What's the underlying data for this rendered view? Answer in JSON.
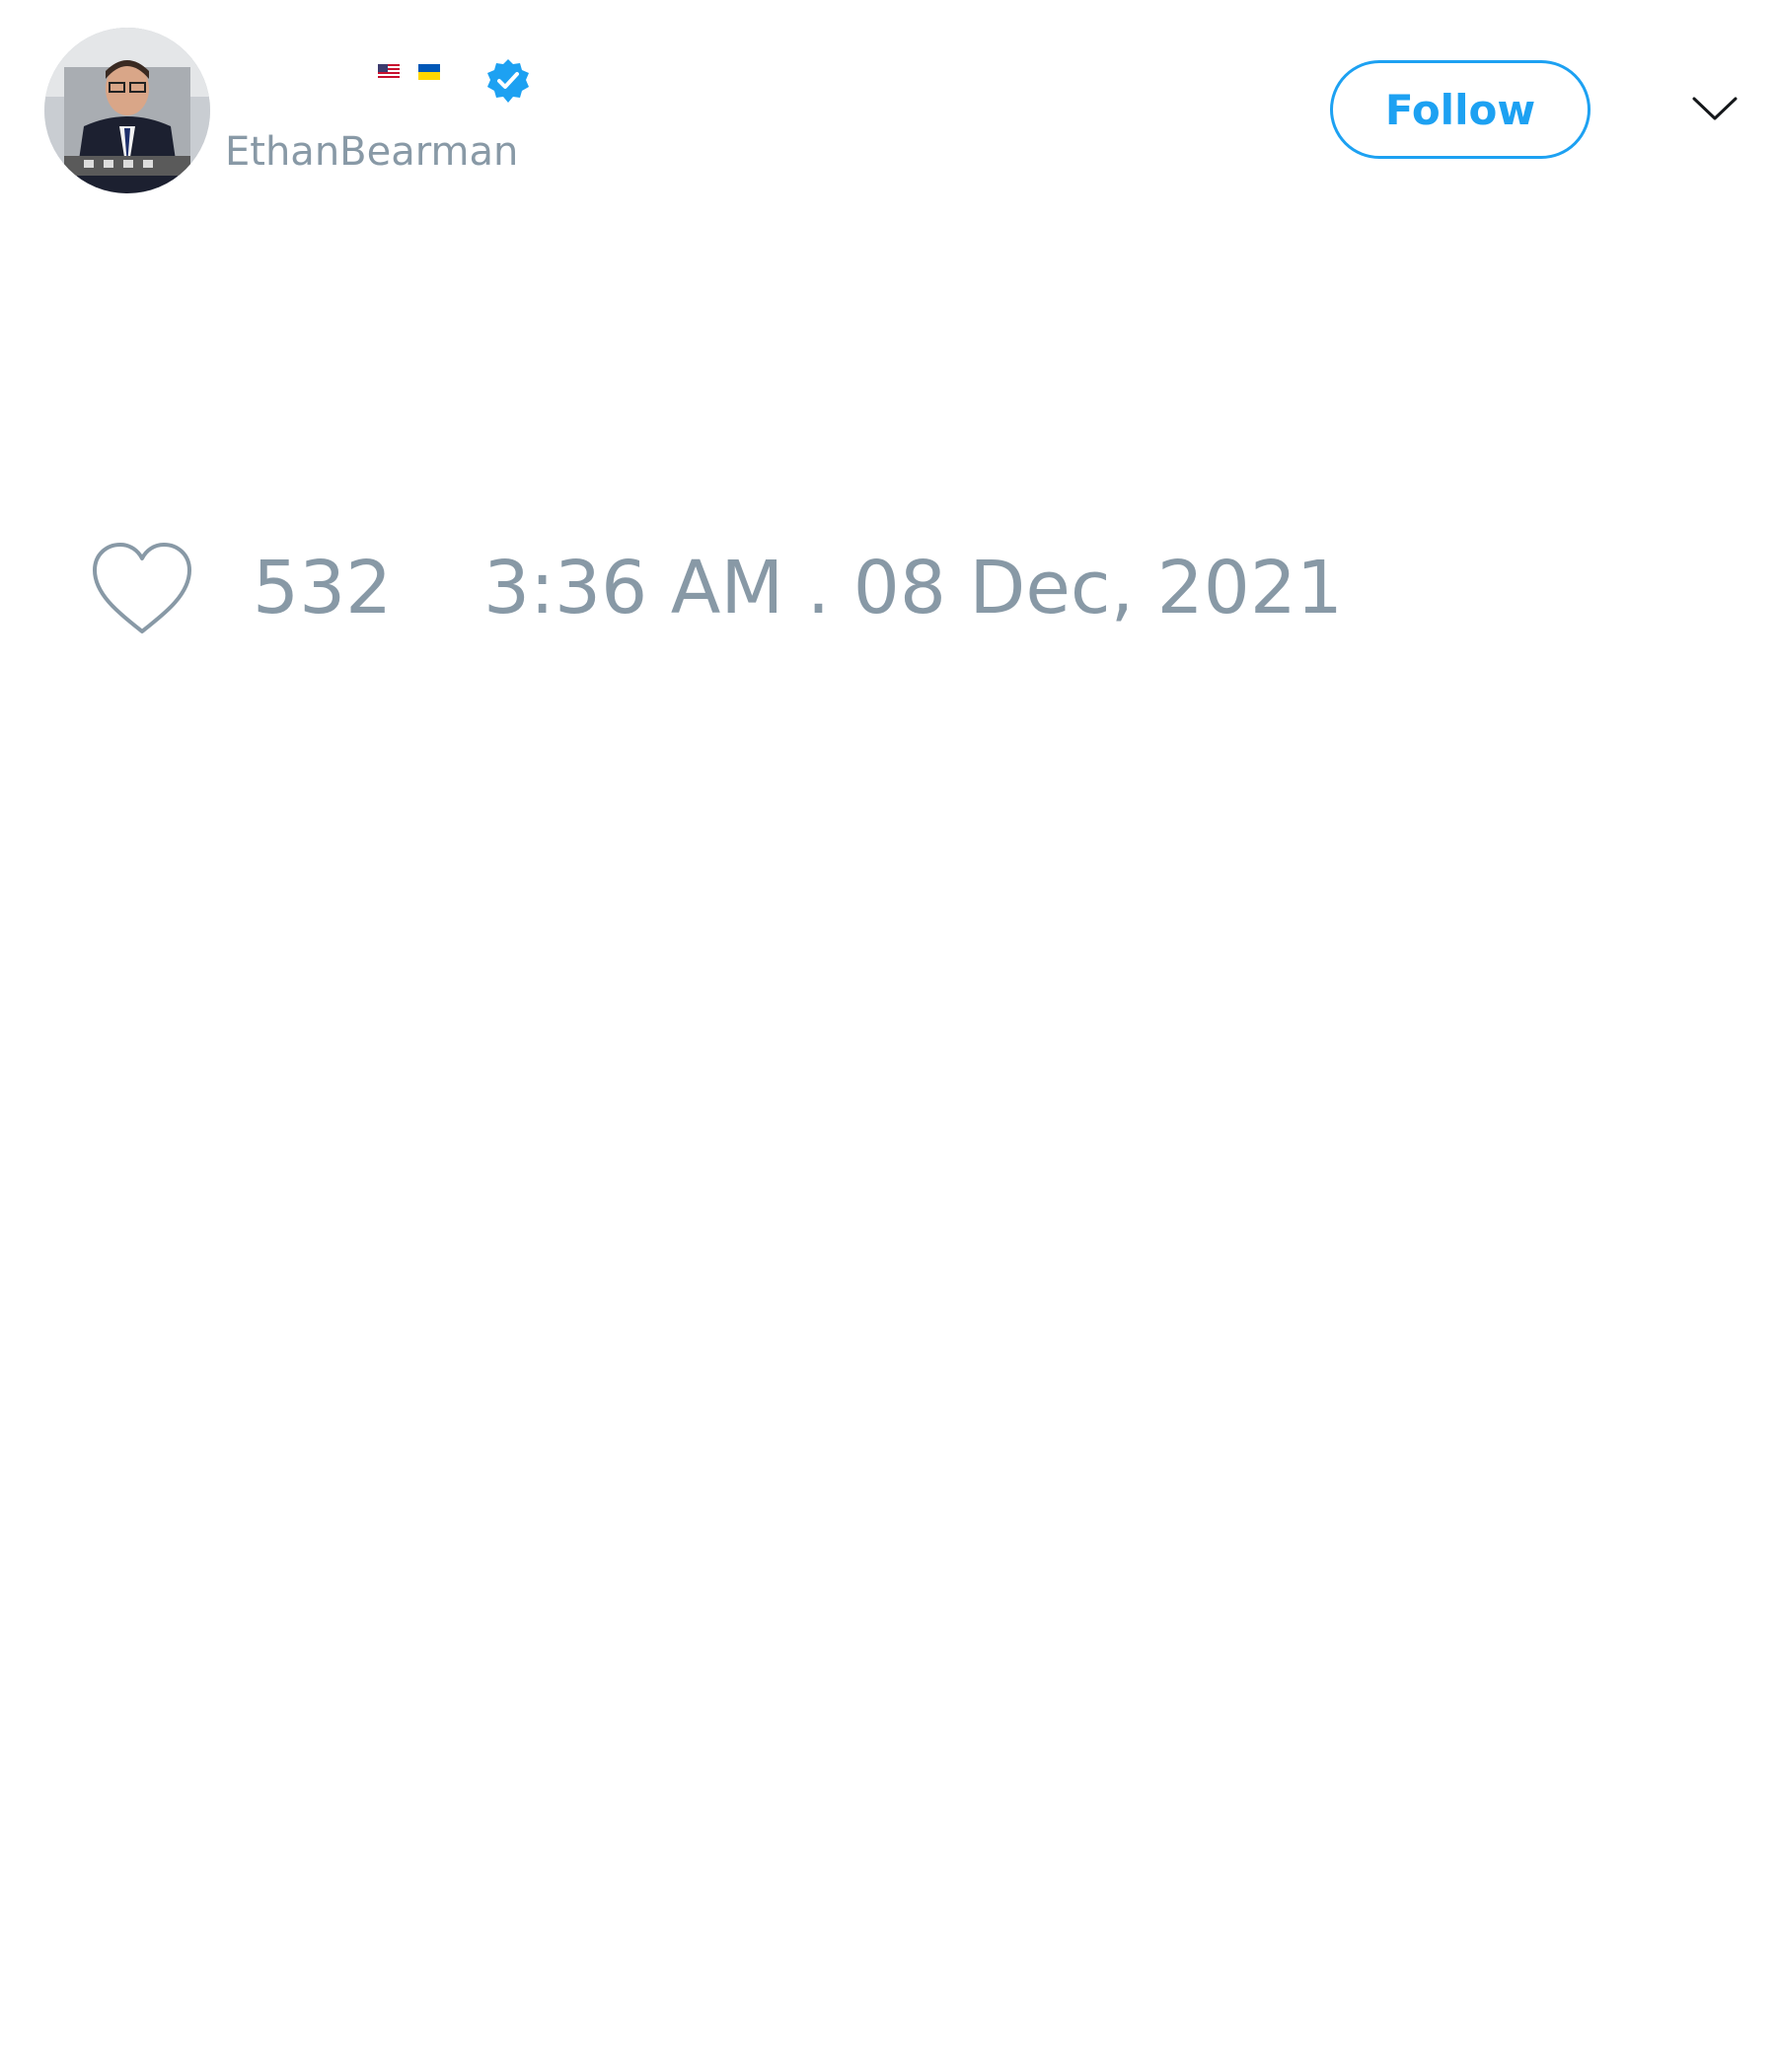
{
  "author": {
    "handle": "EthanBearman",
    "verified": true,
    "name_flags": [
      "us-flag",
      "ukraine-flag"
    ]
  },
  "header": {
    "follow_label": "Follow",
    "menu_icon": "chevron-down-icon"
  },
  "stats": {
    "like_icon": "heart-outline-icon",
    "like_count": "532",
    "timestamp": "3:36 AM . 08 Dec, 2021"
  },
  "colors": {
    "accent": "#1da1f2",
    "muted_text": "#8899a6",
    "background": "#ffffff"
  }
}
